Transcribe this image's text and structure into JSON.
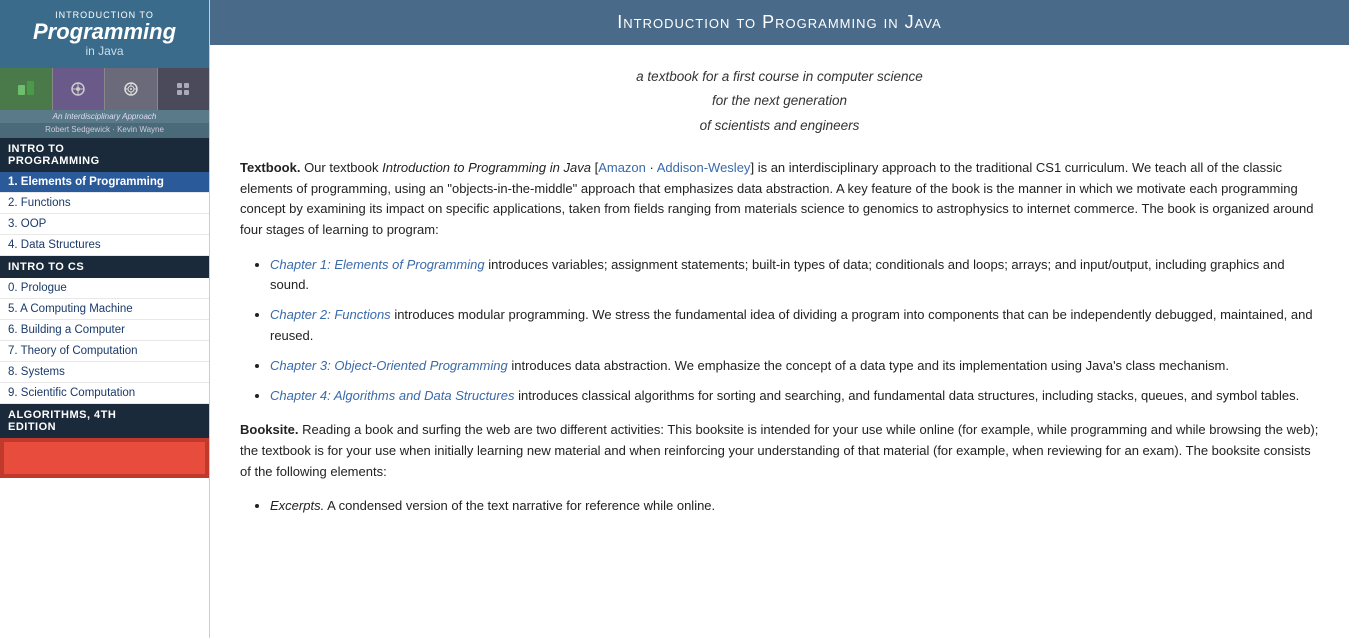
{
  "sidebar": {
    "book_cover": {
      "intro_label": "INTRODUCTION TO",
      "title": "Programming",
      "subtitle": "in Java"
    },
    "cover_subtitle": "An Interdisciplinary Approach",
    "cover_authors": "Robert Sedgewick · Kevin Wayne",
    "nav_sections": [
      {
        "header": "Intro to Programming",
        "items": [
          {
            "number": "1.",
            "label": "Elements of Programming",
            "active": true
          },
          {
            "number": "2.",
            "label": "Functions",
            "active": false
          },
          {
            "number": "3.",
            "label": "OOP",
            "active": false
          },
          {
            "number": "4.",
            "label": "Data Structures",
            "active": false
          }
        ]
      },
      {
        "header": "Intro to CS",
        "items": [
          {
            "number": "0.",
            "label": "Prologue",
            "active": false
          },
          {
            "number": "5.",
            "label": "A Computing Machine",
            "active": false
          },
          {
            "number": "6.",
            "label": "Building a Computer",
            "active": false
          },
          {
            "number": "7.",
            "label": "Theory of Computation",
            "active": false
          },
          {
            "number": "8.",
            "label": "Systems",
            "active": false
          },
          {
            "number": "9.",
            "label": "Scientific Computation",
            "active": false
          }
        ]
      },
      {
        "header": "Algorithms, 4th Edition",
        "items": []
      }
    ]
  },
  "main": {
    "header_title": "Introduction to Programming in Java",
    "subtitle_lines": [
      "a textbook for a first course in computer science",
      "for the next generation",
      "of scientists and engineers"
    ],
    "textbook_label": "Textbook.",
    "textbook_body": " Our textbook ",
    "textbook_title_italic": "Introduction to Programming in Java",
    "textbook_link1": "Amazon",
    "textbook_link2": "Addison-Wesley",
    "textbook_rest": " is an interdisciplinary approach to the traditional CS1 curriculum. We teach all of the classic elements of programming, using an \"objects-in-the-middle\" approach that emphasizes data abstraction. A key feature of the book is the manner in which we motivate each programming concept by examining its impact on specific applications, taken from fields ranging from materials science to genomics to astrophysics to internet commerce. The book is organized around four stages of learning to program:",
    "chapters": [
      {
        "link_text": "Chapter 1: Elements of Programming",
        "description": " introduces variables; assignment statements; built-in types of data; conditionals and loops; arrays; and input/output, including graphics and sound."
      },
      {
        "link_text": "Chapter 2: Functions",
        "description": " introduces modular programming. We stress the fundamental idea of dividing a program into components that can be independently debugged, maintained, and reused."
      },
      {
        "link_text": "Chapter 3: Object-Oriented Programming",
        "description": " introduces data abstraction. We emphasize the concept of a data type and its implementation using Java's class mechanism."
      },
      {
        "link_text": "Chapter 4: Algorithms and Data Structures",
        "description": " introduces classical algorithms for sorting and searching, and fundamental data structures, including stacks, queues, and symbol tables."
      }
    ],
    "booksite_label": "Booksite.",
    "booksite_body": " Reading a book and surfing the web are two different activities: This booksite is intended for your use while online (for example, while programming and while browsing the web); the textbook is for your use when initially learning new material and when reinforcing your understanding of that material (for example, when reviewing for an exam). The booksite consists of the following elements:",
    "excerpts_label": "Excerpts.",
    "excerpts_body": " A condensed version of the text narrative for reference while online."
  }
}
